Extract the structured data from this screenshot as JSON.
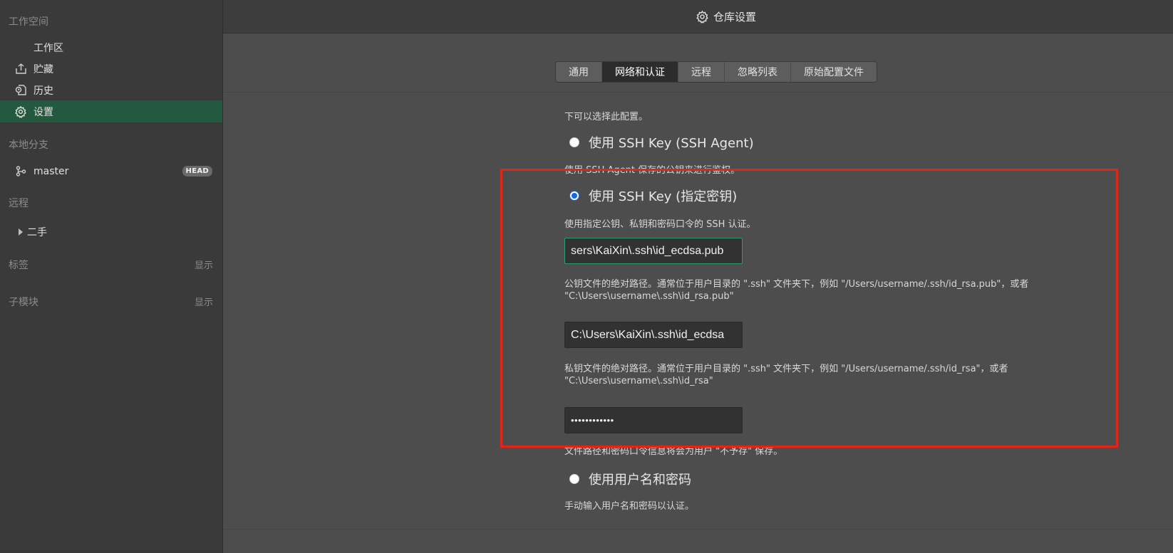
{
  "sidebar": {
    "workspace_header": "工作空间",
    "items": [
      {
        "label": "工作区",
        "icon": "none"
      },
      {
        "label": "贮藏",
        "icon": "stash-icon"
      },
      {
        "label": "历史",
        "icon": "history-icon"
      },
      {
        "label": "设置",
        "icon": "gear-icon",
        "active": true
      }
    ],
    "local_branches_header": "本地分支",
    "branch": {
      "name": "master",
      "badge": "HEAD"
    },
    "remotes_header": "远程",
    "remote": {
      "name": "二手"
    },
    "tags_header": "标签",
    "tags_show": "显示",
    "submodules_header": "子模块",
    "submodules_show": "显示"
  },
  "topbar": {
    "title": "仓库设置",
    "icon": "gear-icon"
  },
  "tabs": [
    {
      "label": "通用",
      "active": false
    },
    {
      "label": "网络和认证",
      "active": true
    },
    {
      "label": "远程",
      "active": false
    },
    {
      "label": "忽略列表",
      "active": false
    },
    {
      "label": "原始配置文件",
      "active": false
    }
  ],
  "auth": {
    "intro_text": "下可以选择此配置。",
    "option_agent": {
      "label": "使用 SSH Key (SSH Agent)",
      "desc": "使用 SSH Agent 保存的公钥来进行鉴权。",
      "checked": false
    },
    "option_key": {
      "label": "使用 SSH Key (指定密钥)",
      "desc": "使用指定公钥、私钥和密码口令的 SSH 认证。",
      "checked": true
    },
    "public_key_value": "sers\\KaiXin\\.ssh\\id_ecdsa.pub",
    "public_key_help_1": "公钥文件的绝对路径。通常位于用户目录的 \".ssh\" 文件夹下，例如 \"/Users/username/.ssh/id_rsa.pub\"，或者",
    "public_key_help_2": "\"C:\\Users\\username\\.ssh\\id_rsa.pub\"",
    "private_key_value": "C:\\Users\\KaiXin\\.ssh\\id_ecdsa",
    "private_key_help_1": "私钥文件的绝对路径。通常位于用户目录的 \".ssh\" 文件夹下，例如 \"/Users/username/.ssh/id_rsa\"，或者",
    "private_key_help_2": "\"C:\\Users\\username\\.ssh\\id_rsa\"",
    "passphrase_value": "••••••••••••",
    "storage_note": "文件路径和密码口令信息将会为用户 \"不予存\" 保存。",
    "option_password": {
      "label": "使用用户名和密码",
      "desc": "手动输入用户名和密码以认证。",
      "checked": false
    }
  },
  "colors": {
    "sidebar_bg": "#3a3a3a",
    "active_item_bg": "#235a3f",
    "content_bg": "#4d4d4d",
    "highlight_red": "#e4241b",
    "radio_checked": "#1468e0"
  }
}
